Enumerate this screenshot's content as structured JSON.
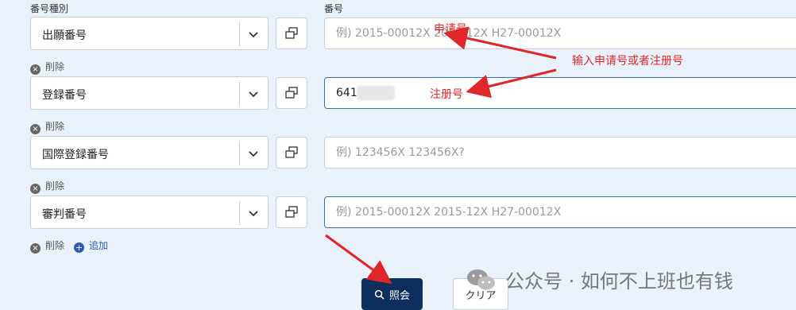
{
  "labels": {
    "type_label": "番号種別",
    "number_label": "番号"
  },
  "rows": [
    {
      "type": "出願番号",
      "placeholder": "例) 2015-00012X 2015-12X H27-00012X",
      "value": ""
    },
    {
      "type": "登録番号",
      "placeholder": "",
      "value": "641"
    },
    {
      "type": "国際登録番号",
      "placeholder": "例) 123456X 123456X?",
      "value": ""
    },
    {
      "type": "審判番号",
      "placeholder": "例) 2015-00012X 2015-12X H27-00012X",
      "value": ""
    }
  ],
  "delete_label": "削除",
  "add_label": "追加",
  "search_button": "照会",
  "clear_button": "クリア",
  "annotations": {
    "app_number": "申请号",
    "reg_number": "注册号",
    "hint": "输入申请号或者注册号"
  },
  "watermark": "公众号 · 如何不上班也有钱",
  "colors": {
    "accent": "#0d2f5e",
    "annotation": "#e0262a",
    "link": "#2a5db0"
  }
}
